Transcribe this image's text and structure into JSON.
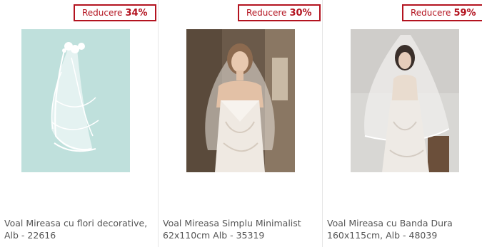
{
  "products": [
    {
      "badge_label": "Reducere",
      "badge_percent": "34%",
      "title": "Voal Mireasa cu flori decorative, Alb - 22616",
      "image_name": "white-veil-with-flowers-photo"
    },
    {
      "badge_label": "Reducere",
      "badge_percent": "30%",
      "title": "Voal Mireasa Simplu Minimalist 62x110cm Alb - 35319",
      "image_name": "bride-wearing-simple-veil-photo"
    },
    {
      "badge_label": "Reducere",
      "badge_percent": "59%",
      "title": "Voal Mireasa cu Banda Dura 160x115cm, Alb - 48039",
      "image_name": "bride-wearing-banded-veil-photo"
    }
  ],
  "colors": {
    "badge_red": "#b3131f",
    "title_gray": "#555555",
    "divider": "#e6e6e6"
  }
}
